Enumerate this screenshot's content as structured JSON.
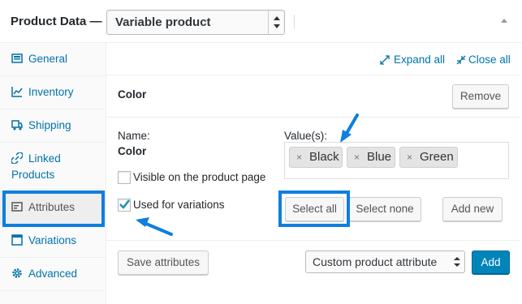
{
  "header": {
    "title": "Product Data —",
    "product_type": "Variable product"
  },
  "sidebar": {
    "items": [
      {
        "label": "General",
        "icon": "general-icon"
      },
      {
        "label": "Inventory",
        "icon": "inventory-icon"
      },
      {
        "label": "Shipping",
        "icon": "shipping-icon"
      },
      {
        "label": "Linked",
        "label2": "Products",
        "icon": "link-icon"
      },
      {
        "label": "Attributes",
        "icon": "attributes-icon",
        "active": true
      },
      {
        "label": "Variations",
        "icon": "variations-icon"
      },
      {
        "label": "Advanced",
        "icon": "gear-icon"
      }
    ]
  },
  "toolbar": {
    "expand_all": "Expand all",
    "close_all": "Close all"
  },
  "attribute": {
    "title": "Color",
    "remove_label": "Remove",
    "name_label": "Name:",
    "name_value": "Color",
    "values_label": "Value(s):",
    "values": [
      "Black",
      "Blue",
      "Green"
    ],
    "remove_value_glyph": "×",
    "visible_label": "Visible on the product page",
    "visible_checked": false,
    "variations_label": "Used for variations",
    "variations_checked": true,
    "select_all_label": "Select all",
    "select_none_label": "Select none",
    "add_new_label": "Add new"
  },
  "footer": {
    "save_label": "Save attributes",
    "attribute_select_value": "Custom product attribute",
    "add_label": "Add"
  },
  "colors": {
    "link": "#0073aa",
    "highlight": "#0f7ee0",
    "primary_button": "#0085ba"
  }
}
